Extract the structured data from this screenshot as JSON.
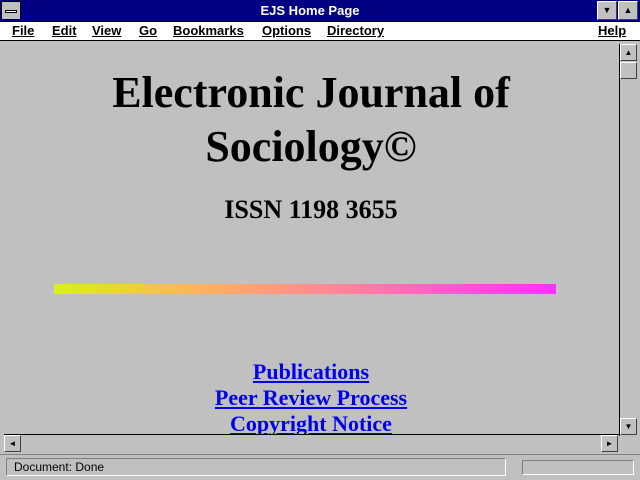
{
  "window": {
    "title": "EJS Home Page"
  },
  "menu": {
    "items": [
      {
        "label": "File"
      },
      {
        "label": "Edit"
      },
      {
        "label": "View"
      },
      {
        "label": "Go"
      },
      {
        "label": "Bookmarks"
      },
      {
        "label": "Options"
      },
      {
        "label": "Directory"
      },
      {
        "label": "Help"
      }
    ]
  },
  "page": {
    "title_line1": "Electronic Journal of",
    "title_line2": "Sociology©",
    "issn": "ISSN 1198 3655",
    "rule_colors": [
      "#d8f020",
      "#ffb060",
      "#ff80a0",
      "#ff30ff"
    ],
    "links": [
      {
        "label": "Publications"
      },
      {
        "label": "Peer Review Process"
      },
      {
        "label": "Copyright Notice"
      }
    ]
  },
  "status": {
    "text": "Document: Done"
  },
  "icons": {
    "minimize": "down-arrow-icon",
    "maximize": "up-arrow-icon",
    "scroll_up": "up-arrow-icon",
    "scroll_down": "down-arrow-icon",
    "scroll_left": "left-arrow-icon",
    "scroll_right": "right-arrow-icon"
  }
}
